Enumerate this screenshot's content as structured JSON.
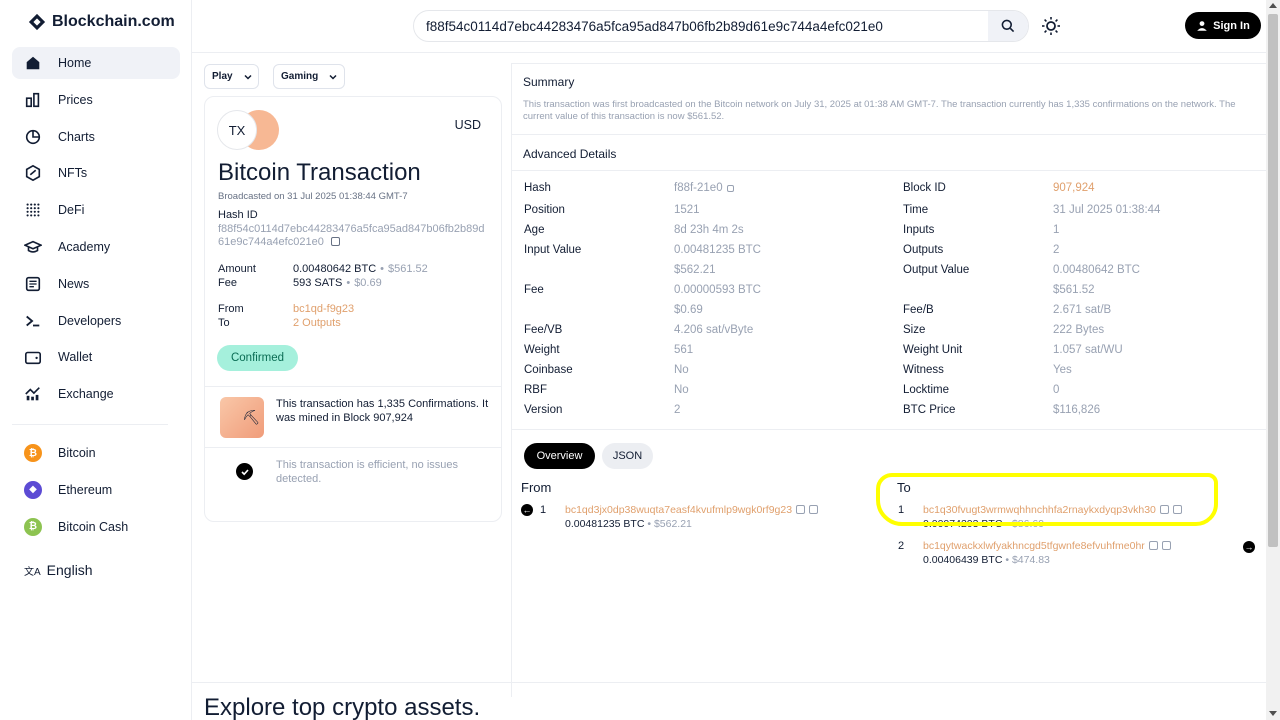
{
  "brand": {
    "name": "Blockchain.com"
  },
  "nav": [
    {
      "label": "Home",
      "icon": "home-icon",
      "active": true
    },
    {
      "label": "Prices",
      "icon": "prices-icon"
    },
    {
      "label": "Charts",
      "icon": "charts-icon"
    },
    {
      "label": "NFTs",
      "icon": "nfts-icon"
    },
    {
      "label": "DeFi",
      "icon": "defi-icon"
    },
    {
      "label": "Academy",
      "icon": "academy-icon"
    },
    {
      "label": "News",
      "icon": "news-icon"
    },
    {
      "label": "Developers",
      "icon": "developers-icon"
    },
    {
      "label": "Wallet",
      "icon": "wallet-icon"
    },
    {
      "label": "Exchange",
      "icon": "exchange-icon"
    }
  ],
  "coins": [
    {
      "label": "Bitcoin",
      "color": "#f7931a",
      "glyph": "₿"
    },
    {
      "label": "Ethereum",
      "color": "#5c4bd4",
      "glyph": "◆"
    },
    {
      "label": "Bitcoin Cash",
      "color": "#8dc351",
      "glyph": "₿"
    }
  ],
  "language": "English",
  "search": {
    "value": "f88f54c0114d7ebc44283476a5fca95ad847b06fb2b89d61e9c744a4efc021e0"
  },
  "header": {
    "signin": "Sign In"
  },
  "filters": {
    "play": "Play",
    "gaming": "Gaming"
  },
  "card": {
    "badge": "TX",
    "currency": "USD",
    "title": "Bitcoin Transaction",
    "broadcast": "Broadcasted on 31 Jul 2025 01:38:44 GMT-7",
    "hash_label": "Hash ID",
    "hash_value": "f88f54c0114d7ebc44283476a5fca95ad847b06fb2b89d61e9c744a4efc021e0",
    "amount_label": "Amount",
    "amount_btc": "0.00480642 BTC",
    "amount_usd": "$561.52",
    "fee_label": "Fee",
    "fee_sats": "593 SATS",
    "fee_usd": "$0.69",
    "from_label": "From",
    "from_value": "bc1qd-f9g23",
    "to_label": "To",
    "to_value": "2 Outputs",
    "status": "Confirmed",
    "mined_text": "This transaction has 1,335 Confirmations. It was mined in Block 907,924",
    "efficient_text": "This transaction is efficient, no issues detected."
  },
  "summary": {
    "title": "Summary",
    "text": "This transaction was first broadcasted on the Bitcoin network on July 31, 2025 at 01:38 AM GMT-7. The transaction currently has 1,335 confirmations on the network. The current value of this transaction is now $561.52."
  },
  "advanced": {
    "title": "Advanced Details",
    "left": [
      {
        "k": "Hash",
        "v": "f88f-21e0"
      },
      {
        "k": "Position",
        "v": "1521"
      },
      {
        "k": "Age",
        "v": "8d 23h 4m 2s"
      },
      {
        "k": "Input Value",
        "v": "0.00481235 BTC",
        "v2": "$562.21"
      },
      {
        "k": "Fee",
        "v": "0.00000593 BTC",
        "v2": "$0.69"
      },
      {
        "k": "Fee/VB",
        "v": "4.206 sat/vByte"
      },
      {
        "k": "Weight",
        "v": "561"
      },
      {
        "k": "Coinbase",
        "v": "No"
      },
      {
        "k": "RBF",
        "v": "No"
      },
      {
        "k": "Version",
        "v": "2"
      }
    ],
    "right": [
      {
        "k": "Block ID",
        "v": "907,924"
      },
      {
        "k": "Time",
        "v": "31 Jul 2025 01:38:44"
      },
      {
        "k": "Inputs",
        "v": "1"
      },
      {
        "k": "Outputs",
        "v": "2"
      },
      {
        "k": "Output Value",
        "v": "0.00480642 BTC",
        "v2": "$561.52"
      },
      {
        "k": "Fee/B",
        "v": "2.671 sat/B"
      },
      {
        "k": "Size",
        "v": "222 Bytes"
      },
      {
        "k": "Weight Unit",
        "v": "1.057 sat/WU"
      },
      {
        "k": "Witness",
        "v": "Yes"
      },
      {
        "k": "Locktime",
        "v": "0"
      },
      {
        "k": "BTC Price",
        "v": "$116,826"
      }
    ]
  },
  "tabs": {
    "overview": "Overview",
    "json": "JSON"
  },
  "flow": {
    "from_title": "From",
    "to_title": "To",
    "inputs": [
      {
        "idx": "1",
        "addr": "bc1qd3jx0dp38wuqta7easf4kvufmlp9wgk0rf9g23",
        "btc": "0.00481235",
        "unit": "BTC",
        "usd": "$562.21"
      }
    ],
    "outputs": [
      {
        "idx": "1",
        "addr": "bc1q30fvugt3wrmwqhhnchhfa2rnaykxdyqp3vkh30",
        "btc": "0.00074203",
        "unit": "BTC",
        "usd": "$86.69"
      },
      {
        "idx": "2",
        "addr": "bc1qytwackxlwfyakhncgd5tfgwnfe8efvuhfme0hr",
        "btc": "0.00406439",
        "unit": "BTC",
        "usd": "$474.83"
      }
    ]
  },
  "explore": "Explore top crypto assets.",
  "colors": {
    "accent_orange": "#e0a06d",
    "confirmed_bg": "#a5f0dc",
    "highlight": "#ffff00"
  }
}
